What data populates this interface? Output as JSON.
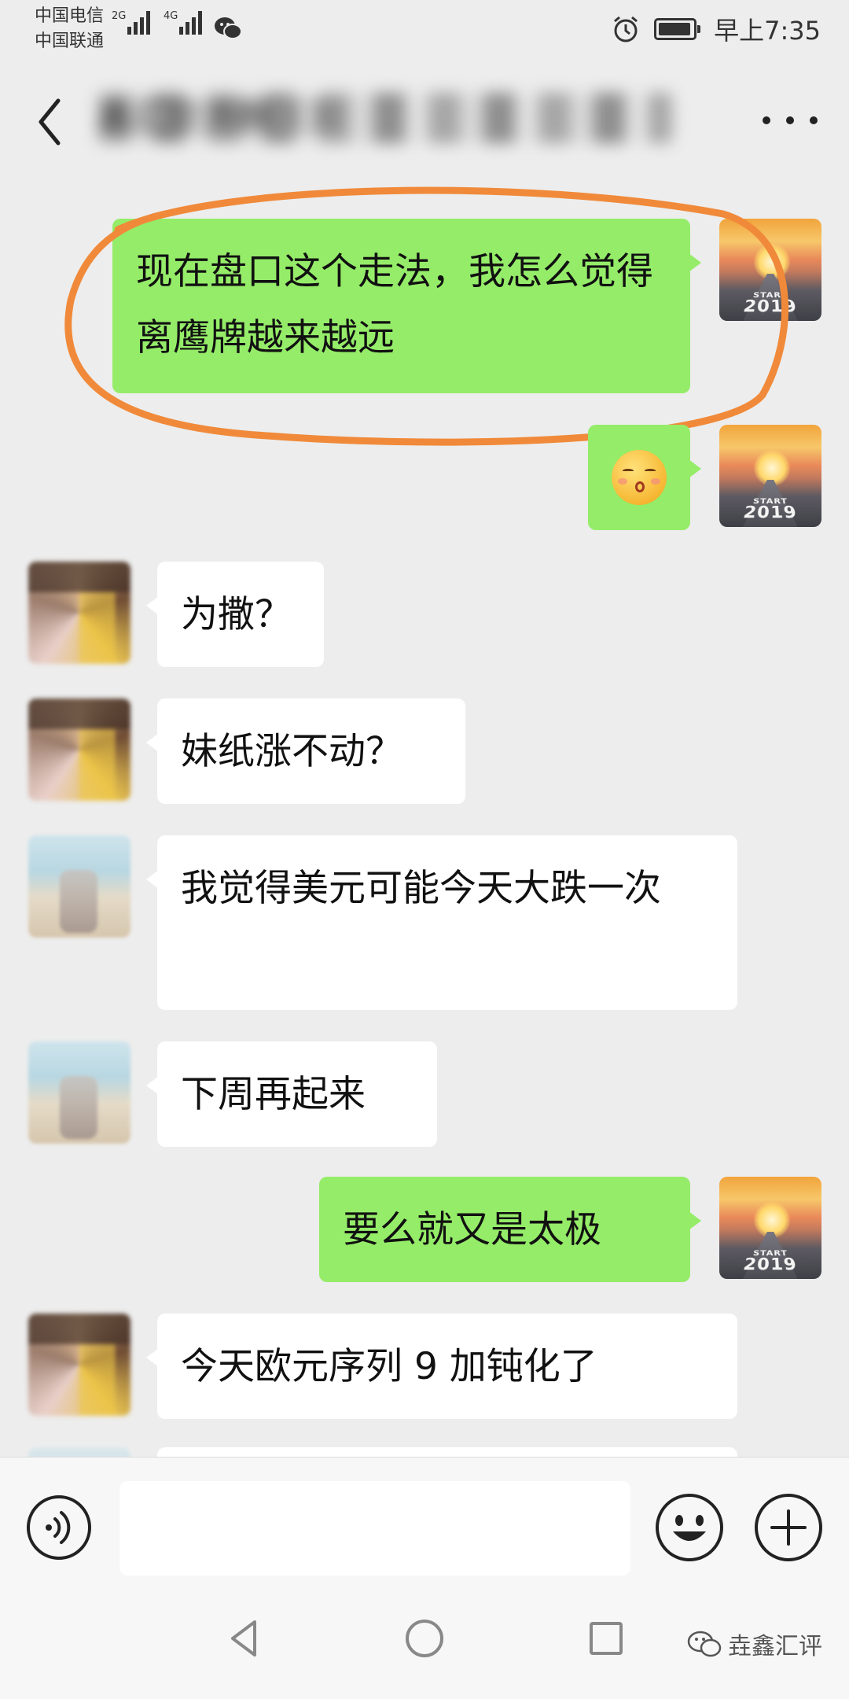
{
  "status_bar": {
    "carrier_1": "中国电信",
    "carrier_2": "中国联通",
    "sig1_tag": "2G",
    "sig2_tag": "4G",
    "time": "早上7:35"
  },
  "header": {
    "title": "鑫汇交流群（3）"
  },
  "messages": [
    {
      "side": "me",
      "text": "现在盘口这个走法，我怎么觉得离鹰牌越来越远"
    },
    {
      "side": "me",
      "text": "",
      "emoji": "shy-face-emoji"
    },
    {
      "side": "them",
      "text": "为撒？"
    },
    {
      "side": "them",
      "text": "妹纸涨不动？"
    },
    {
      "side": "them",
      "text": "我觉得美元可能今天大跌一次"
    },
    {
      "side": "them",
      "text": "下周再起来"
    },
    {
      "side": "me",
      "text": "要么就又是太极"
    },
    {
      "side": "them",
      "text": "今天欧元序列 9 加钝化了"
    }
  ],
  "self_avatar": {
    "text_small": "START",
    "text_year": "2019"
  },
  "input": {
    "placeholder": "",
    "value": ""
  },
  "watermark": {
    "text": "垚鑫汇评"
  },
  "colors": {
    "my_bubble": "#95ec69",
    "their_bubble": "#ffffff",
    "background": "#ededed",
    "annotation": "#f08a3a"
  }
}
